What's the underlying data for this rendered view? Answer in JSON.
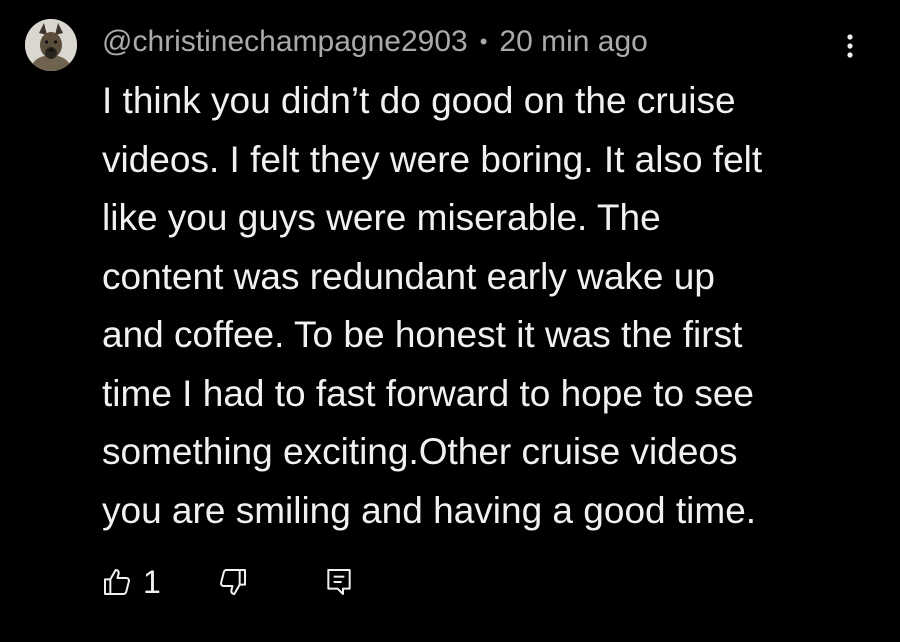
{
  "comment": {
    "author": "@christinechampagne2903",
    "separator": "•",
    "timestamp": "20 min ago",
    "text_lines": [
      "I think you didn’t do good on the cruise",
      "videos. I felt they were boring. It also felt",
      "like you guys were miserable. The",
      "content was redundant early wake up",
      "and coffee. To be honest it was the first",
      "time I had to fast forward to hope to see",
      "something exciting.Other cruise videos",
      "you are smiling and having a good time."
    ],
    "like_count": "1"
  },
  "icons": {
    "more": "more-vert-icon",
    "like": "thumb-up-icon",
    "dislike": "thumb-down-icon",
    "reply": "reply-comment-icon"
  },
  "colors": {
    "background": "#000000",
    "text": "#f1f1f1",
    "meta": "#aaaaaa"
  }
}
